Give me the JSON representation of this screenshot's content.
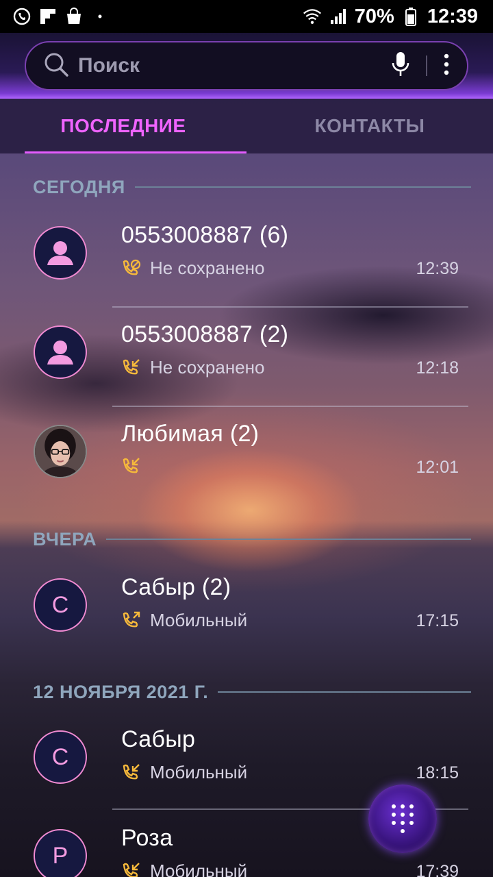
{
  "status_bar": {
    "battery_percent": "70%",
    "time": "12:39",
    "left_icons": [
      "missed-call-status-icon",
      "flipboard-icon",
      "shopping-bag-icon",
      "dot-icon"
    ],
    "right_icons": [
      "wifi-icon",
      "signal-icon",
      "battery-icon"
    ]
  },
  "search": {
    "placeholder": "Поиск"
  },
  "tabs": [
    {
      "label": "ПОСЛЕДНИЕ",
      "active": true
    },
    {
      "label": "КОНТАКТЫ",
      "active": false
    }
  ],
  "sections": [
    {
      "label": "СЕГОДНЯ",
      "calls": [
        {
          "name": "0553008887 (6)",
          "subtitle": "Не сохранено",
          "time": "12:39",
          "call_type": "blocked",
          "avatar": "person-icon"
        },
        {
          "name": "0553008887 (2)",
          "subtitle": "Не сохранено",
          "time": "12:18",
          "call_type": "incoming",
          "avatar": "person-icon"
        },
        {
          "name": "Любимая (2)",
          "subtitle": "",
          "time": "12:01",
          "call_type": "incoming",
          "avatar": "photo"
        }
      ]
    },
    {
      "label": "ВЧЕРА",
      "calls": [
        {
          "name": "Сабыр (2)",
          "subtitle": "Мобильный",
          "time": "17:15",
          "call_type": "outgoing",
          "avatar_letter": "С"
        }
      ]
    },
    {
      "label": "12 НОЯБРЯ 2021 Г.",
      "calls": [
        {
          "name": "Сабыр",
          "subtitle": "Мобильный",
          "time": "18:15",
          "call_type": "incoming",
          "avatar_letter": "С"
        },
        {
          "name": "Роза",
          "subtitle": "Мобильный",
          "time": "17:39",
          "call_type": "incoming",
          "avatar_letter": "Р"
        }
      ]
    }
  ],
  "colors": {
    "accent": "#f064ff",
    "call_icon": "#f6b93b",
    "section_label": "#8fa6bd",
    "avatar_fill": "#161840",
    "avatar_ring": "#f08ad2"
  }
}
